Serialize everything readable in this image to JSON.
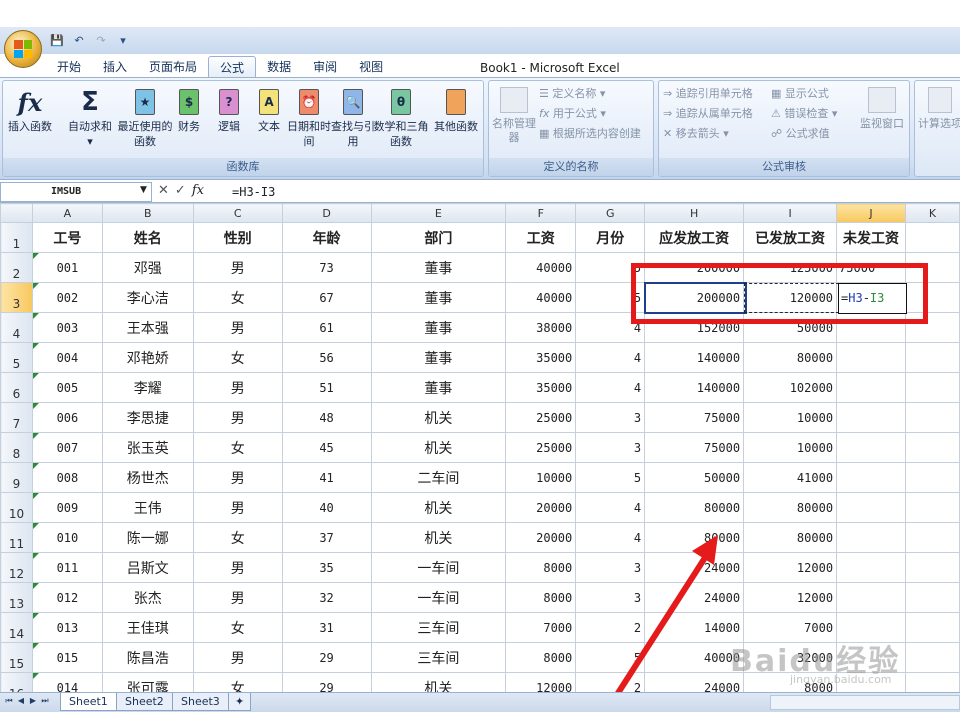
{
  "window_title": "Book1 - Microsoft Excel",
  "ribbon_tabs": [
    "开始",
    "插入",
    "页面布局",
    "公式",
    "数据",
    "审阅",
    "视图"
  ],
  "active_tab": "公式",
  "ribbon": {
    "function_library": {
      "label": "函数库",
      "buttons": [
        "插入函数",
        "自动求和",
        "最近使用的函数",
        "财务",
        "逻辑",
        "文本",
        "日期和时间",
        "查找与引用",
        "数学和三角函数",
        "其他函数"
      ]
    },
    "defined_names": {
      "label": "定义的名称",
      "name_manager": "名称管理器",
      "define_name": "定义名称",
      "use_in_formula": "用于公式",
      "create_from_selection": "根据所选内容创建"
    },
    "formula_auditing": {
      "label": "公式审核",
      "trace_precedents": "追踪引用单元格",
      "trace_dependents": "追踪从属单元格",
      "remove_arrows": "移去箭头",
      "show_formulas": "显示公式",
      "error_checking": "错误检查",
      "evaluate_formula": "公式求值",
      "watch_window": "监视窗口"
    },
    "calculation": {
      "options": "计算选项"
    }
  },
  "formula_bar": {
    "name_box": "IMSUB",
    "formula": "=H3-I3"
  },
  "columns": [
    "A",
    "B",
    "C",
    "D",
    "E",
    "F",
    "G",
    "H",
    "I",
    "J",
    "K"
  ],
  "header_row": [
    "工号",
    "姓名",
    "性别",
    "年龄",
    "部门",
    "工资",
    "月份",
    "应发放工资",
    "已发放工资",
    "未发工资"
  ],
  "rows": [
    {
      "rownum": "2",
      "cells": [
        "001",
        "邓强",
        "男",
        "73",
        "董事",
        "40000",
        "5",
        "200000",
        "125000",
        "75000"
      ]
    },
    {
      "rownum": "3",
      "cells": [
        "002",
        "李心洁",
        "女",
        "67",
        "董事",
        "40000",
        "5",
        "200000",
        "120000",
        ""
      ]
    },
    {
      "rownum": "4",
      "cells": [
        "003",
        "王本强",
        "男",
        "61",
        "董事",
        "38000",
        "4",
        "152000",
        "50000",
        ""
      ]
    },
    {
      "rownum": "5",
      "cells": [
        "004",
        "邓艳娇",
        "女",
        "56",
        "董事",
        "35000",
        "4",
        "140000",
        "80000",
        ""
      ]
    },
    {
      "rownum": "6",
      "cells": [
        "005",
        "李耀",
        "男",
        "51",
        "董事",
        "35000",
        "4",
        "140000",
        "102000",
        ""
      ]
    },
    {
      "rownum": "7",
      "cells": [
        "006",
        "李思捷",
        "男",
        "48",
        "机关",
        "25000",
        "3",
        "75000",
        "10000",
        ""
      ]
    },
    {
      "rownum": "8",
      "cells": [
        "007",
        "张玉英",
        "女",
        "45",
        "机关",
        "25000",
        "3",
        "75000",
        "10000",
        ""
      ]
    },
    {
      "rownum": "9",
      "cells": [
        "008",
        "杨世杰",
        "男",
        "41",
        "二车间",
        "10000",
        "5",
        "50000",
        "41000",
        ""
      ]
    },
    {
      "rownum": "10",
      "cells": [
        "009",
        "王伟",
        "男",
        "40",
        "机关",
        "20000",
        "4",
        "80000",
        "80000",
        ""
      ]
    },
    {
      "rownum": "11",
      "cells": [
        "010",
        "陈一娜",
        "女",
        "37",
        "机关",
        "20000",
        "4",
        "80000",
        "80000",
        ""
      ]
    },
    {
      "rownum": "12",
      "cells": [
        "011",
        "吕斯文",
        "男",
        "35",
        "一车间",
        "8000",
        "3",
        "24000",
        "12000",
        ""
      ]
    },
    {
      "rownum": "13",
      "cells": [
        "012",
        "张杰",
        "男",
        "32",
        "一车间",
        "8000",
        "3",
        "24000",
        "12000",
        ""
      ]
    },
    {
      "rownum": "14",
      "cells": [
        "013",
        "王佳琪",
        "女",
        "31",
        "三车间",
        "7000",
        "2",
        "14000",
        "7000",
        ""
      ]
    },
    {
      "rownum": "15",
      "cells": [
        "015",
        "陈昌浩",
        "男",
        "29",
        "三车间",
        "8000",
        "5",
        "40000",
        "32000",
        ""
      ]
    },
    {
      "rownum": "16",
      "cells": [
        "014",
        "张可露",
        "女",
        "29",
        "机关",
        "12000",
        "2",
        "24000",
        "8000",
        ""
      ]
    }
  ],
  "sheet_tabs": [
    "Sheet1",
    "Sheet2",
    "Sheet3"
  ],
  "watermark": "Baidu经验",
  "watermark_sub": "jingyan.baidu.com",
  "colors": {
    "highlight": "#e51a1a",
    "selection": "#1e3f8a",
    "formula_ref_H": "#1f3bb3",
    "formula_ref_I": "#2e8b3a"
  }
}
